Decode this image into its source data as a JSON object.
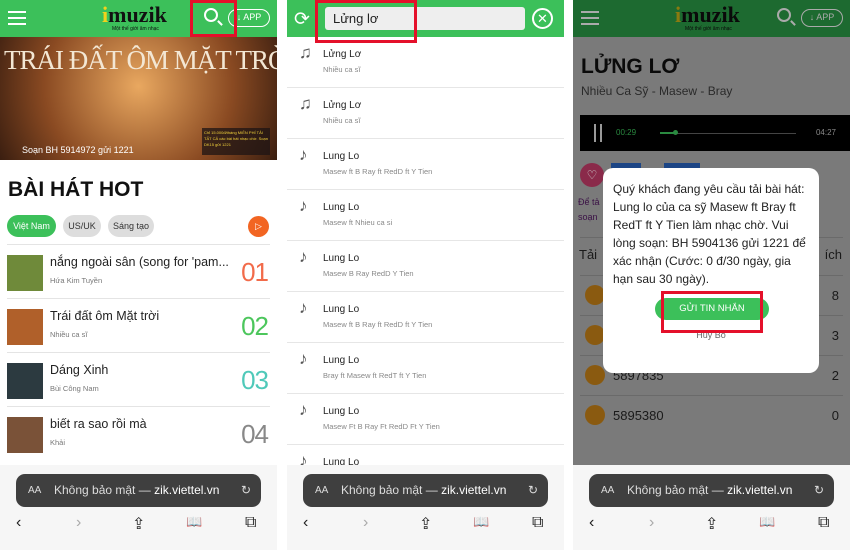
{
  "brand": {
    "logo": "muzik",
    "tagline": "Một thế giới âm nhạc",
    "app_label": "↓ APP",
    "color": "#3cc05a",
    "highlight": "#e4102a"
  },
  "browser": {
    "aa": "AA",
    "url_prefix": "Không bảo mật — ",
    "url_host": "zik.viettel.vn",
    "reload": "↻",
    "back": "‹",
    "forward": "›",
    "share": "⇪",
    "bookmarks": "📖",
    "tabs": "⧉"
  },
  "home": {
    "banner_title": "TRÁI ĐẤT ÔM MẶT TRỜI",
    "banner_sms": "Soạn BH 5914972 gửi 1221",
    "promo": "Chỉ 15.000đ/tháng MIỄN PHÍ TẢI TẤT CẢ các bài hát nhạc chờ. Soạn DK15 gửi 1221",
    "section_title": "BÀI HÁT HOT",
    "chips": [
      "Việt Nam",
      "US/UK",
      "Sáng tạo"
    ],
    "songs": [
      {
        "title": "nắng ngoài sân (song for 'pam...",
        "artist": "Hứa Kim Tuyền",
        "rank": "01",
        "color": "#f26b4a"
      },
      {
        "title": "Trái đất ôm Mặt trời",
        "artist": "Nhiều ca sĩ",
        "rank": "02",
        "color": "#4cc65c"
      },
      {
        "title": "Dáng Xinh",
        "artist": "Bùi Công Nam",
        "rank": "03",
        "color": "#4fc9b9"
      },
      {
        "title": "biết ra sao rồi mà",
        "artist": "Khải",
        "rank": "04",
        "color": "#888888"
      }
    ]
  },
  "search": {
    "query": "Lửng lơ",
    "results": [
      {
        "title": "Lửng Lơ",
        "artist": "Nhiều ca sĩ",
        "icon": "music-notes-icon"
      },
      {
        "title": "Lửng Lơ",
        "artist": "Nhiều ca sĩ",
        "icon": "music-notes-icon"
      },
      {
        "title": "Lung Lo",
        "artist": "Masew ft B Ray ft RedD ft Y Tien",
        "icon": "ringtone-icon"
      },
      {
        "title": "Lung Lo",
        "artist": "Masew ft Nhieu ca si",
        "icon": "ringtone-icon"
      },
      {
        "title": "Lung Lo",
        "artist": "Masew B Ray RedD Y Tien",
        "icon": "ringtone-icon"
      },
      {
        "title": "Lung Lo",
        "artist": "Masew ft B Ray ft RedD ft Y Tien",
        "icon": "ringtone-icon"
      },
      {
        "title": "Lung Lo",
        "artist": "Bray ft Masew ft RedT ft Y Tien",
        "icon": "ringtone-icon"
      },
      {
        "title": "Lung Lo",
        "artist": "Masew Ft B Ray Ft RedD Ft Y Tien",
        "icon": "ringtone-icon"
      },
      {
        "title": "Lung Lo",
        "artist": "",
        "icon": "ringtone-icon"
      }
    ]
  },
  "song": {
    "title": "LỬNG LƠ",
    "artists": "Nhiều Ca Sỹ - Masew - Bray",
    "elapsed": "00:29",
    "duration": "04:27",
    "progress": 0.11,
    "partial_text1": "Để tả",
    "partial_text2": "soạn",
    "col_left": "Tải",
    "col_right": "ích",
    "codes": [
      {
        "code": "",
        "count": "8"
      },
      {
        "code": "",
        "count": "3"
      },
      {
        "code": "5897835",
        "count": "2"
      },
      {
        "code": "5895380",
        "count": "0"
      }
    ],
    "dialog": {
      "message": "Quý khách đang yêu cầu tải bài hát: Lung lo của ca sỹ Masew ft Bray ft RedT ft Y Tien làm nhạc chờ. Vui lòng soạn: BH 5904136 gửi 1221 để xác nhận (Cước: 0 đ/30 ngày, gia hạn sau 30 ngày).",
      "confirm": "GỬI TIN NHẮN",
      "cancel": "Hủy Bỏ"
    }
  }
}
